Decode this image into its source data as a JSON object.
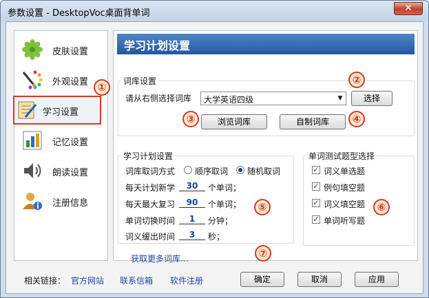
{
  "window": {
    "title": "参数设置 - DesktopVoc桌面背单词",
    "close_glyph": "✕"
  },
  "nav": {
    "items": [
      {
        "label": "皮肤设置",
        "icon": "skin-flower-icon"
      },
      {
        "label": "外观设置",
        "icon": "palette-brush-icon"
      },
      {
        "label": "学习设置",
        "icon": "study-notebook-icon",
        "selected": true
      },
      {
        "label": "记忆设置",
        "icon": "memory-chart-icon"
      },
      {
        "label": "朗读设置",
        "icon": "speaker-icon"
      },
      {
        "label": "注册信息",
        "icon": "user-info-icon"
      }
    ]
  },
  "panel": {
    "title": "学习计划设置"
  },
  "lexicon": {
    "group_title": "词库设置",
    "prompt": "请从右侧选择词库",
    "selected_lexicon": "大学英语四级",
    "select_label": "选择",
    "browse_label": "浏览词库",
    "custom_label": "自制词库"
  },
  "plan": {
    "group_title": "学习计划设置",
    "mode_label": "词库取词方式",
    "mode_options": [
      "顺序取词",
      "随机取词"
    ],
    "selected_mode": "随机取词",
    "daily_new_prefix": "每天计划新学",
    "daily_new_value": "30",
    "daily_new_suffix": "个单词；",
    "daily_review_prefix": "每天最大复习",
    "daily_review_value": "90",
    "daily_review_suffix": "个单词；",
    "switch_prefix": "单词切换时间",
    "switch_value": "1",
    "switch_suffix": "分钟；",
    "delay_prefix": "词义缓出时间",
    "delay_value": "3",
    "delay_suffix": "秒；"
  },
  "quiz": {
    "group_title": "单词测试题型选择",
    "options": [
      {
        "label": "词义单选题",
        "checked": true
      },
      {
        "label": "例句填空题",
        "checked": true
      },
      {
        "label": "词义填空题",
        "checked": true
      },
      {
        "label": "单词听写题",
        "checked": true
      }
    ]
  },
  "more_link": "获取更多词库...",
  "footer": {
    "links_label": "相关链接：",
    "links": [
      "官方网站",
      "联系信箱",
      "软件注册"
    ],
    "ok_label": "确定",
    "cancel_label": "取消",
    "apply_label": "应用"
  },
  "annotations": [
    "①",
    "②",
    "③",
    "④",
    "⑤",
    "⑥",
    "⑦"
  ],
  "colors": {
    "banner": "#2f63ad",
    "highlight": "#d23a2a",
    "link": "#1d49a6"
  }
}
